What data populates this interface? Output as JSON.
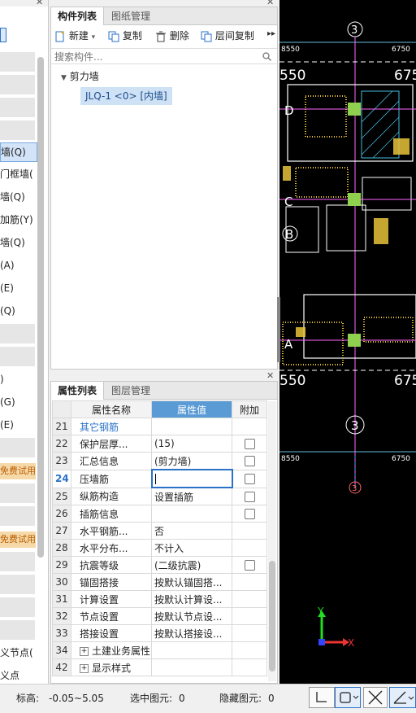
{
  "left_sidebar": {
    "items": [
      {
        "label": "墙(Q)",
        "type": "selected"
      },
      {
        "label": "门框墙(",
        "type": "text"
      },
      {
        "label": "墙(Q)",
        "type": "text"
      },
      {
        "label": "加筋(Y)",
        "type": "text"
      },
      {
        "label": "墙(Q)",
        "type": "text"
      },
      {
        "label": "(A)",
        "type": "text"
      },
      {
        "label": "(E)",
        "type": "text"
      },
      {
        "label": "(Q)",
        "type": "text"
      },
      {
        "label": ")",
        "type": "text"
      },
      {
        "label": "(G)",
        "type": "text"
      },
      {
        "label": "(E)",
        "type": "text"
      },
      {
        "label": "免费试用",
        "type": "badge"
      },
      {
        "label": "免费试用",
        "type": "badge"
      },
      {
        "label": "义节点(",
        "type": "text"
      },
      {
        "label": "义点",
        "type": "text"
      }
    ]
  },
  "component_panel": {
    "tabs": [
      "构件列表",
      "图纸管理"
    ],
    "toolbar": {
      "new": "新建",
      "copy": "复制",
      "delete": "删除",
      "floor_copy": "层间复制"
    },
    "search_placeholder": "搜索构件...",
    "tree": {
      "group": "剪力墙",
      "item": "JLQ-1 <0> [内墙]"
    }
  },
  "property_panel": {
    "tabs": [
      "属性列表",
      "图层管理"
    ],
    "headers": {
      "name": "属性名称",
      "value": "属性值",
      "extra": "附加"
    },
    "rows": [
      {
        "num": "21",
        "name": "其它钢筋",
        "value": "",
        "check": false,
        "link": true
      },
      {
        "num": "22",
        "name": "保护层厚...",
        "value": "(15)",
        "check": true
      },
      {
        "num": "23",
        "name": "汇总信息",
        "value": "(剪力墙)",
        "check": true
      },
      {
        "num": "24",
        "name": "压墙筋",
        "value": "",
        "check": true,
        "editing": true
      },
      {
        "num": "25",
        "name": "纵筋构造",
        "value": "设置插筋",
        "check": true
      },
      {
        "num": "26",
        "name": "插筋信息",
        "value": "",
        "check": true
      },
      {
        "num": "27",
        "name": "水平钢筋...",
        "value": "否",
        "check": false
      },
      {
        "num": "28",
        "name": "水平分布...",
        "value": "不计入",
        "check": false
      },
      {
        "num": "29",
        "name": "抗震等级",
        "value": "(二级抗震)",
        "check": true
      },
      {
        "num": "30",
        "name": "锚固搭接",
        "value": "按默认锚固搭...",
        "check": false
      },
      {
        "num": "31",
        "name": "计算设置",
        "value": "按默认计算设...",
        "check": false
      },
      {
        "num": "32",
        "name": "节点设置",
        "value": "按默认节点设...",
        "check": false
      },
      {
        "num": "33",
        "name": "搭接设置",
        "value": "按默认搭接设...",
        "check": false
      },
      {
        "num": "34",
        "name": "土建业务属性",
        "value": "",
        "check": false,
        "expand": true
      },
      {
        "num": "42",
        "name": "显示样式",
        "value": "",
        "check": false,
        "expand": true
      }
    ]
  },
  "cad": {
    "labels": {
      "dim_left": "8550",
      "dim_right": "6750",
      "axis_550_top": "550",
      "axis_675_top": "675",
      "axis_550_bottom": "550",
      "axis_675_bottom": "675",
      "row_d": "D",
      "row_c": "C",
      "row_b": "B",
      "row_a": "A",
      "col_3": "3",
      "dim_left_bottom": "8550",
      "dim_right_bottom": "6750",
      "ucs_y": "Y",
      "ucs_x": "X"
    },
    "colors": {
      "background": "#000000",
      "wall": "#ffffff",
      "hatch": "#e8c33a",
      "column": "#8fd14f",
      "annotation": "#ffff00",
      "axis_line": "#ff66ff"
    }
  },
  "status_bar": {
    "elevation_label": "标高:",
    "elevation_value": "-0.05~5.05",
    "selected_label": "选中图元:",
    "selected_value": "0",
    "hidden_label": "隐藏图元:",
    "hidden_value": "0"
  }
}
